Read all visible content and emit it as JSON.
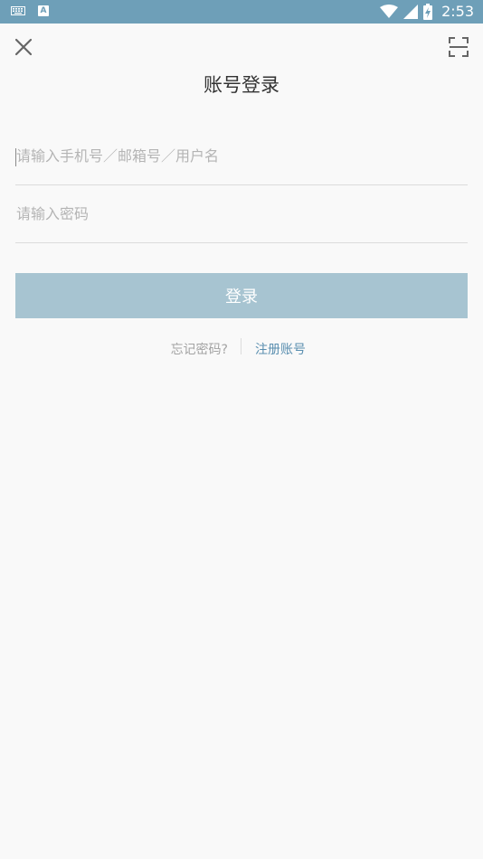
{
  "status_bar": {
    "time": "2:53",
    "icons": [
      "keyboard-icon",
      "a-icon",
      "wifi-icon",
      "signal-icon",
      "battery-charging-icon"
    ]
  },
  "header": {
    "close_icon": "close-icon",
    "scan_icon": "scan-icon",
    "title": "账号登录"
  },
  "form": {
    "account_placeholder": "请输入手机号／邮箱号／用户名",
    "account_value": "",
    "password_placeholder": "请输入密码",
    "password_value": "",
    "login_label": "登录"
  },
  "links": {
    "forgot_label": "忘记密码?",
    "register_label": "注册账号"
  },
  "colors": {
    "status_bar": "#6e9fb8",
    "button": "#a7c4d1",
    "link": "#5a8fb0",
    "background": "#f9f9f9"
  }
}
